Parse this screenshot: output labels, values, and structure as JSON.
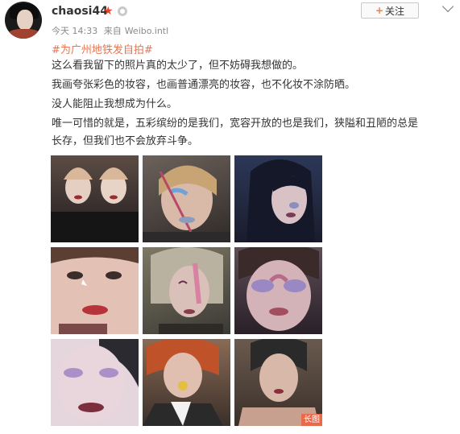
{
  "header": {
    "username": "chaosi44",
    "follow_label": "关注",
    "time": "今天 14:33",
    "source_prefix": "来自",
    "source": "Weibo.intl"
  },
  "post": {
    "topic": "#为广州地铁发自拍#",
    "lines": [
      "这么看我留下的照片真的太少了，但不妨碍我想做的。",
      "我画夸张彩色的妆容，也画普通漂亮的妆容，也不化妆不涂防晒。",
      "没人能阻止我想成为什么。",
      "唯一可惜的就是，五彩缤纷的是我们，宽容开放的也是我们，狭隘和丑陋的总是",
      "长存，但我们也不会放弃斗争。"
    ]
  },
  "photos": {
    "long_image_badge": "长图"
  },
  "icons": {
    "vip": "vip-star-icon",
    "badge": "verified-badge-icon",
    "more": "chevron-down-icon"
  },
  "colors": {
    "topic": "#eb7350",
    "meta": "#8a8a8a",
    "vip": "#e8402b",
    "follow_plus": "#fa7d3c"
  }
}
